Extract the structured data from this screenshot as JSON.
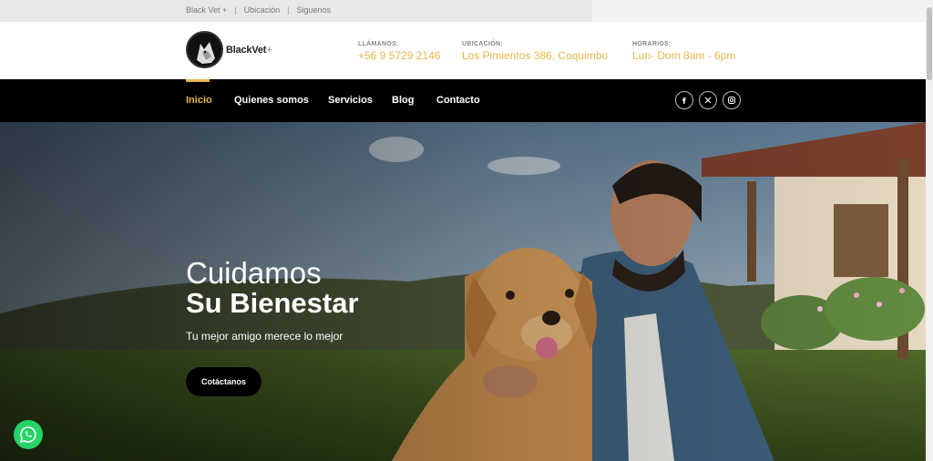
{
  "topbar": {
    "links": [
      "Black Vet +",
      "Ubicación",
      "Siguenos"
    ],
    "separator": "|"
  },
  "header": {
    "logo_text": "BlackVet",
    "logo_plus": "+",
    "contact": [
      {
        "label": "LLÁMANOS:",
        "value": "+56 9 5729 2146"
      },
      {
        "label": "UBICACIÓN:",
        "value": "Los Pimientos 386, Coquimbo"
      },
      {
        "label": "HORARIOS:",
        "value": "Lun- Dom 8am - 6pm"
      }
    ]
  },
  "nav": {
    "items": [
      "Inicio",
      "Quienes somos",
      "Servicios",
      "Blog",
      "Contacto"
    ],
    "active_index": 0,
    "social_icons": [
      "facebook-icon",
      "x-icon",
      "instagram-icon"
    ]
  },
  "hero": {
    "title_line1": "Cuidamos",
    "title_line2": "Su Bienestar",
    "subtitle": "Tu mejor amigo merece lo mejor",
    "cta_label": "Cotáctanos"
  },
  "colors": {
    "accent": "#e8b64a",
    "nav_bg": "#000000",
    "whatsapp": "#25d366"
  }
}
